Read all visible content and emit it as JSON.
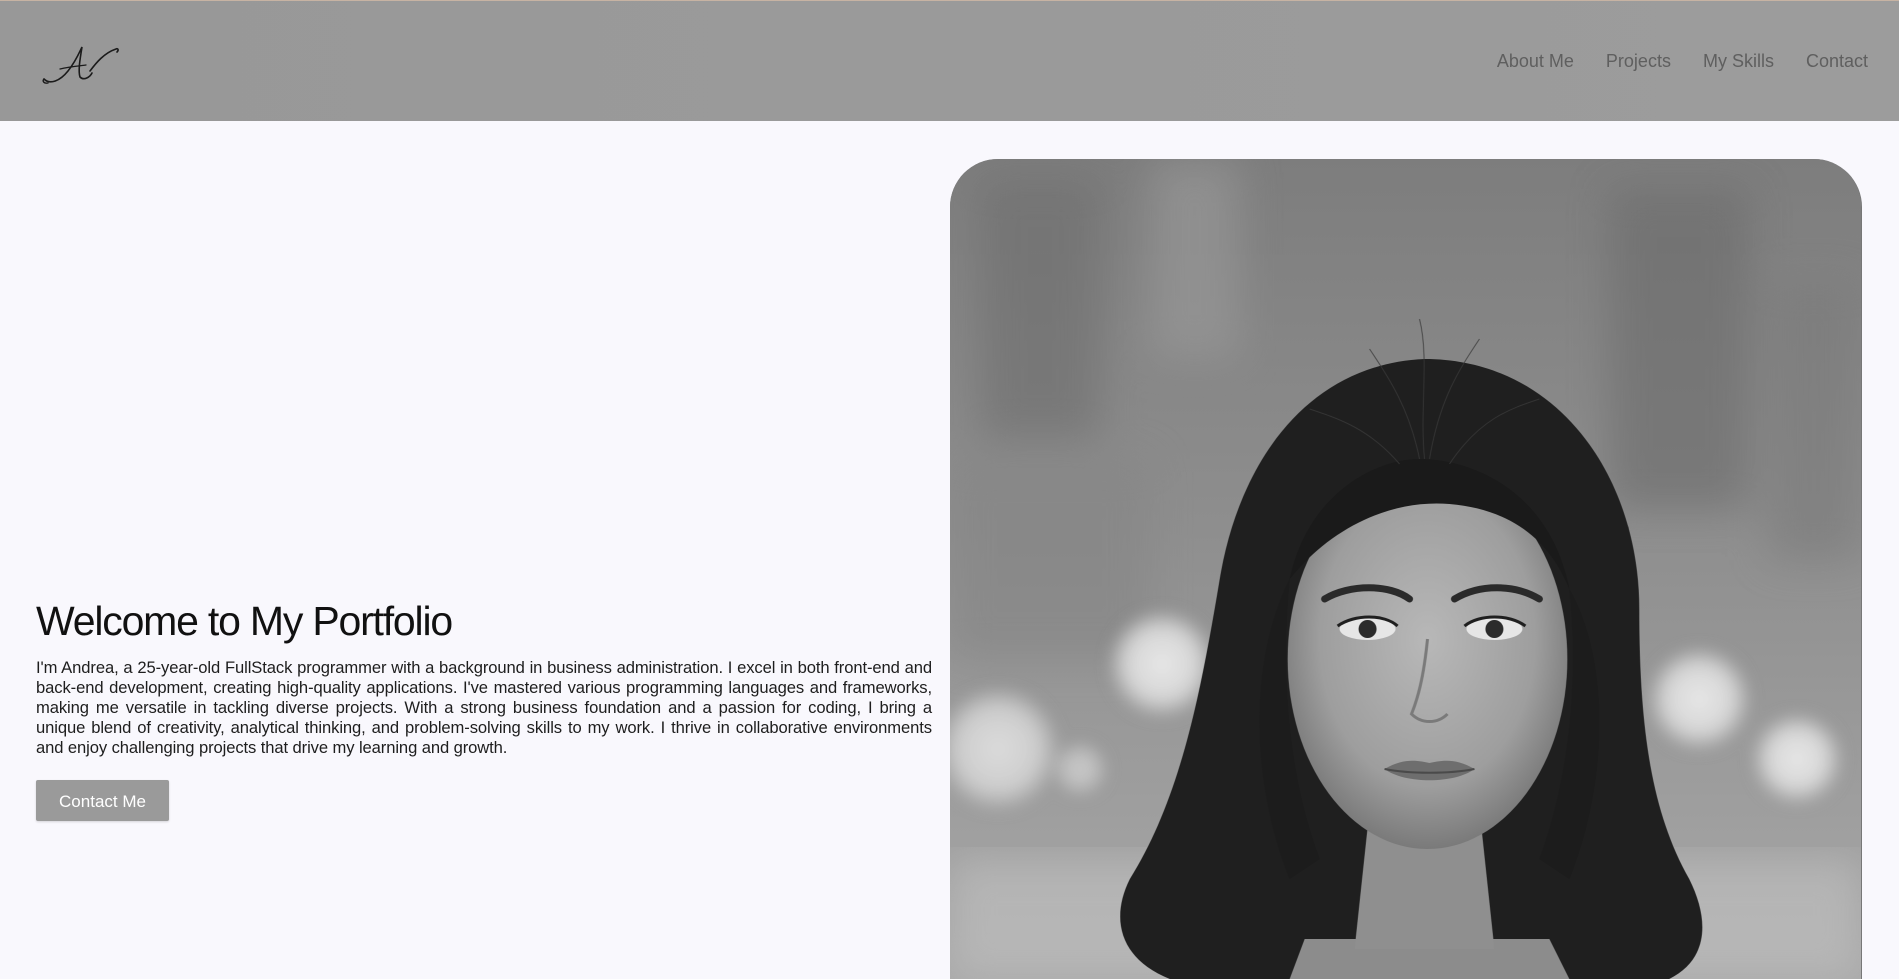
{
  "header": {
    "logo_icon": "signature-logo",
    "nav": [
      {
        "label": "About Me"
      },
      {
        "label": "Projects"
      },
      {
        "label": "My Skills"
      },
      {
        "label": "Contact"
      }
    ]
  },
  "hero": {
    "title": "Welcome to My Portfolio",
    "description": "I'm Andrea, a 25-year-old FullStack programmer with a background in business administration. I excel in both front-end and back-end development, creating high-quality applications. I've mastered various programming languages and frameworks, making me versatile in tackling diverse projects. With a strong business foundation and a passion for coding, I bring a unique blend of creativity, analytical thinking, and problem-solving skills to my work. I thrive in collaborative environments and enjoy challenging projects that drive my learning and growth.",
    "cta_label": "Contact Me"
  },
  "portrait": {
    "icon": "portrait-photo"
  },
  "colors": {
    "header_bg": "#9a9a9a",
    "page_bg": "#f9f8fd",
    "nav_text": "#5f5f5f",
    "button_bg": "#9a9a9a",
    "button_text": "#ffffff"
  }
}
